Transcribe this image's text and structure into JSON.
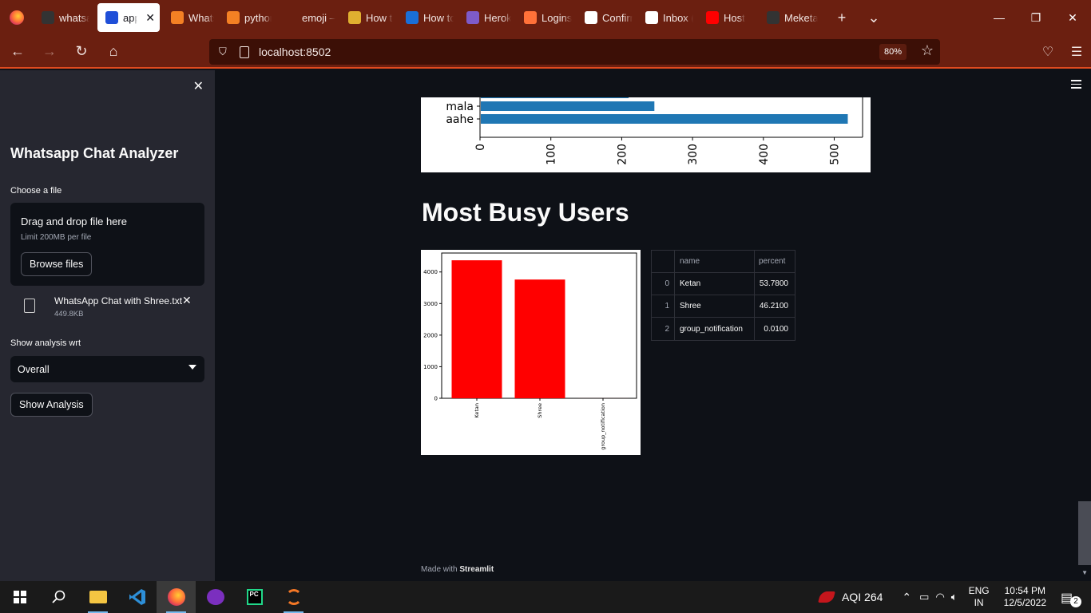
{
  "browser": {
    "tabs": [
      {
        "label": "whatsapp",
        "icon": "github-icon",
        "active": false
      },
      {
        "label": "app",
        "icon": "streamlit-crown-icon",
        "active": true
      },
      {
        "label": "WhatsApp",
        "icon": "stackoverflow-icon",
        "active": false
      },
      {
        "label": "python",
        "icon": "stackoverflow-icon",
        "active": false
      },
      {
        "label": "emoji — en",
        "icon": "generic-page-icon",
        "active": false
      },
      {
        "label": "How to",
        "icon": "bookmark-icon",
        "active": false
      },
      {
        "label": "How to",
        "icon": "k-letter-icon",
        "active": false
      },
      {
        "label": "Heroku",
        "icon": "heroku-icon",
        "active": false
      },
      {
        "label": "Logins",
        "icon": "firefox-icon",
        "active": false
      },
      {
        "label": "Confirm",
        "icon": "gmail-icon",
        "active": false
      },
      {
        "label": "Inbox (",
        "icon": "gmail-icon",
        "active": false
      },
      {
        "label": "Host",
        "icon": "youtube-icon",
        "active": false
      },
      {
        "label": "Meketa",
        "icon": "github-icon",
        "active": false
      }
    ],
    "url": "localhost:8502",
    "zoom": "80%"
  },
  "sidebar": {
    "title": "Whatsapp Chat Analyzer",
    "file_label": "Choose a file",
    "dropzone_main": "Drag and drop file here",
    "dropzone_limit": "Limit 200MB per file",
    "browse_label": "Browse files",
    "uploaded_file_name": "WhatsApp Chat with Shree.txt",
    "uploaded_file_size": "449.8KB",
    "analysis_label": "Show analysis wrt",
    "analysis_value": "Overall",
    "show_button": "Show Analysis"
  },
  "main": {
    "section_title": "Most Busy Users",
    "footer_prefix": "Made with",
    "footer_brand": "Streamlit",
    "table": {
      "columns": [
        "",
        "name",
        "percent"
      ],
      "rows": [
        {
          "index": "0",
          "name": "Ketan",
          "percent": "53.7800"
        },
        {
          "index": "1",
          "name": "Shree",
          "percent": "46.2100"
        },
        {
          "index": "2",
          "name": "group_notification",
          "percent": "0.0100"
        }
      ]
    }
  },
  "chart_data": [
    {
      "type": "bar",
      "orientation": "horizontal",
      "categories": [
        "mala",
        "aahe"
      ],
      "values": [
        245,
        518
      ],
      "xlim": [
        0,
        540
      ],
      "xticks": [
        "0",
        "100",
        "200",
        "300",
        "400",
        "500"
      ],
      "color": "#1f77b4"
    },
    {
      "type": "bar",
      "categories": [
        "Ketan",
        "Shree",
        "group_notification"
      ],
      "values": [
        4370,
        3760,
        1
      ],
      "ylim": [
        0,
        4600
      ],
      "yticks": [
        "0",
        "1000",
        "2000",
        "3000",
        "4000"
      ],
      "color": "#ff0000"
    }
  ],
  "taskbar": {
    "aqi": "AQI 264",
    "lang_top": "ENG",
    "lang_bottom": "IN",
    "time": "10:54 PM",
    "date": "12/5/2022",
    "notifications": "2"
  }
}
